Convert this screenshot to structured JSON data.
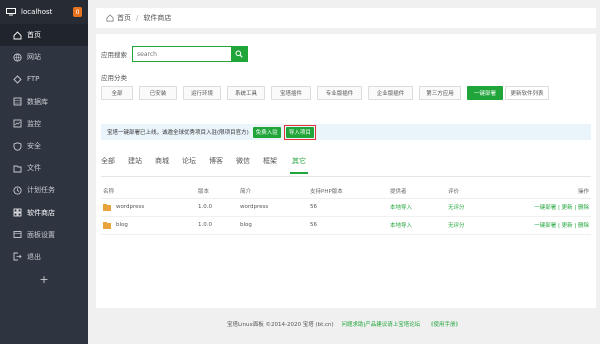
{
  "sidebar": {
    "host": "localhost",
    "badge": "0",
    "items": [
      {
        "label": "首页",
        "icon": "home-icon",
        "active": true
      },
      {
        "label": "网站",
        "icon": "globe-icon"
      },
      {
        "label": "FTP",
        "icon": "ftp-icon"
      },
      {
        "label": "数据库",
        "icon": "database-icon"
      },
      {
        "label": "监控",
        "icon": "monitor-icon"
      },
      {
        "label": "安全",
        "icon": "shield-icon"
      },
      {
        "label": "文件",
        "icon": "folder-icon"
      },
      {
        "label": "计划任务",
        "icon": "clock-icon"
      },
      {
        "label": "软件商店",
        "icon": "grid-icon",
        "current": true
      },
      {
        "label": "面板设置",
        "icon": "settings-icon"
      },
      {
        "label": "退出",
        "icon": "logout-icon"
      }
    ],
    "add": "+"
  },
  "breadcrumb": {
    "home": "首页",
    "sep": "/",
    "current": "软件商店"
  },
  "search": {
    "label": "应用搜索",
    "placeholder": "search"
  },
  "categories": {
    "label": "应用分类",
    "items": [
      "全部",
      "已安装",
      "运行环境",
      "系统工具",
      "宝塔插件",
      "专业版插件",
      "企业版插件",
      "第三方应用",
      "一键部署",
      "更新软件列表"
    ]
  },
  "notice": {
    "text": "宝塔一键部署已上线，诚邀全球优秀项目入驻(限项目官方)",
    "btn_apply": "免费入驻",
    "btn_import": "导入项目"
  },
  "tabs": [
    "全部",
    "建站",
    "商城",
    "论坛",
    "博客",
    "微信",
    "框架",
    "其它"
  ],
  "table": {
    "headers": [
      "名称",
      "版本",
      "简介",
      "支持PHP版本",
      "提供者",
      "评价",
      "操作"
    ],
    "rows": [
      {
        "name": "wordpress",
        "version": "1.0.0",
        "desc": "wordpress",
        "php": "56",
        "provider": "本地导入",
        "rating": "无评分",
        "ops": "一键部署 | 更新 | 删除"
      },
      {
        "name": "blog",
        "version": "1.0.0",
        "desc": "blog",
        "php": "56",
        "provider": "本地导入",
        "rating": "无评分",
        "ops": "一键部署 | 更新 | 删除"
      }
    ]
  },
  "footer": {
    "copyright": "宝塔Linux面板 ©2014-2020 宝塔 (bt.cn)",
    "link1": "问题求助|产品建议请上宝塔论坛",
    "link2": "《使用手册》"
  },
  "colors": {
    "accent": "#20a53a",
    "sidebar": "#2f3540",
    "badge": "#e8731f",
    "highlight_border": "#dd3333"
  }
}
